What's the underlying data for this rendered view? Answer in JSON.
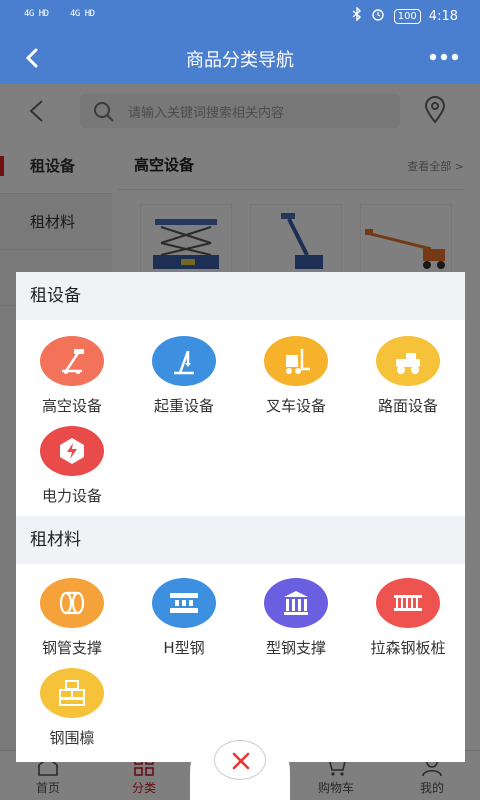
{
  "status": {
    "signal1": "4G HD",
    "signal2": "4G HD",
    "battery": "100",
    "time": "4:18"
  },
  "header": {
    "title": "商品分类导航"
  },
  "search": {
    "placeholder": "请输入关键词搜索相关内容"
  },
  "leftnav": {
    "items": [
      "租设备",
      "租材料"
    ]
  },
  "content": {
    "heading": "高空设备",
    "view_all": "查看全部 >"
  },
  "tabbar": {
    "items": [
      "首页",
      "分类",
      "购物车",
      "我的"
    ]
  },
  "panel": {
    "sections": [
      {
        "title": "租设备",
        "items": [
          {
            "label": "高空设备",
            "icon": "aerial-lift-icon",
            "color": "#f2735a"
          },
          {
            "label": "起重设备",
            "icon": "crane-icon",
            "color": "#3d8fe0"
          },
          {
            "label": "叉车设备",
            "icon": "forklift-icon",
            "color": "#f5b22a"
          },
          {
            "label": "路面设备",
            "icon": "road-roller-icon",
            "color": "#f5c23a"
          },
          {
            "label": "电力设备",
            "icon": "power-icon",
            "color": "#e94a4a"
          }
        ]
      },
      {
        "title": "租材料",
        "items": [
          {
            "label": "钢管支撑",
            "icon": "steel-pipe-icon",
            "color": "#f5a23a"
          },
          {
            "label": "H型钢",
            "icon": "h-beam-icon",
            "color": "#3d8fe0"
          },
          {
            "label": "型钢支撑",
            "icon": "steel-support-icon",
            "color": "#6a5fe0"
          },
          {
            "label": "拉森钢板桩",
            "icon": "sheet-pile-icon",
            "color": "#ef5350"
          },
          {
            "label": "钢围檩",
            "icon": "steel-purlin-icon",
            "color": "#f5c23a"
          }
        ]
      }
    ]
  }
}
